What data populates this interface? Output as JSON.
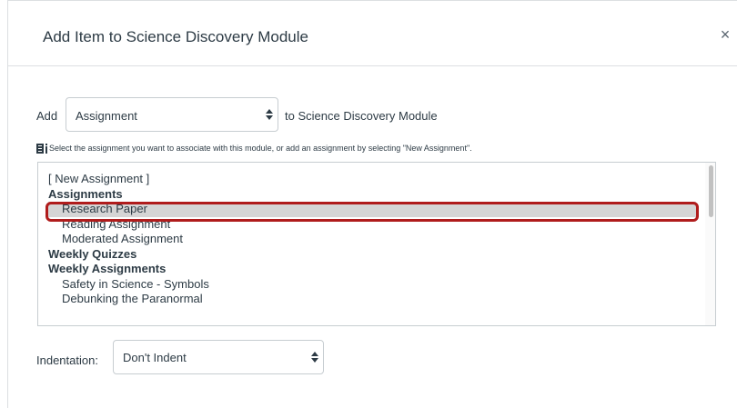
{
  "dialog": {
    "title": "Add Item to Science Discovery Module",
    "close_label": "×"
  },
  "add_row": {
    "add_label": "Add",
    "type_select_value": "Assignment",
    "suffix": "to Science Discovery Module"
  },
  "hint": {
    "icon": "info-icon",
    "text": "Select the assignment you want to associate with this module, or add an assignment by selecting \"New Assignment\"."
  },
  "list": {
    "items": [
      {
        "label": "[ New Assignment ]",
        "kind": "option"
      },
      {
        "label": "Assignments",
        "kind": "group"
      },
      {
        "label": "Research Paper",
        "kind": "child",
        "selected": true
      },
      {
        "label": "Reading Assignment",
        "kind": "child"
      },
      {
        "label": "Moderated Assignment",
        "kind": "child"
      },
      {
        "label": "Weekly Quizzes",
        "kind": "group"
      },
      {
        "label": "Weekly Assignments",
        "kind": "group"
      },
      {
        "label": "Safety in Science - Symbols",
        "kind": "child"
      },
      {
        "label": "Debunking the Paranormal",
        "kind": "child"
      }
    ]
  },
  "indentation": {
    "label": "Indentation:",
    "value": "Don't Indent"
  },
  "colors": {
    "highlight_ring": "#b01c1c",
    "selected_row": "#d5d5d5",
    "text": "#2d3b45",
    "border": "#c7cdd1"
  }
}
